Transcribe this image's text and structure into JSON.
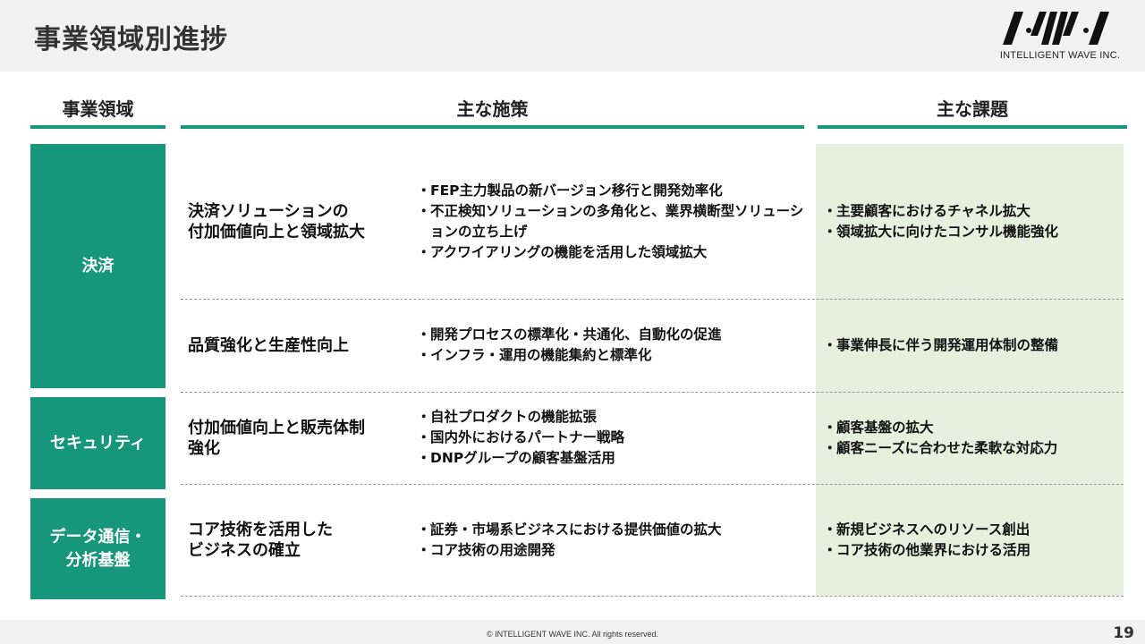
{
  "header": {
    "title": "事業領域別進捗",
    "logo_text": "INTELLIGENT WAVE INC."
  },
  "columns": {
    "domain": "事業領域",
    "measures": "主な施策",
    "issues": "主な課題"
  },
  "domains": [
    "決済",
    "セキュリティ",
    "データ通信・\n分析基盤"
  ],
  "rows": [
    {
      "category": "決済ソリューションの\n付加価値向上と領域拡大",
      "measures": [
        "FEP主力製品の新バージョン移行と開発効率化",
        "不正検知ソリューションの多角化と、業界横断型ソリューションの立ち上げ",
        "アクワイアリングの機能を活用した領域拡大"
      ],
      "issues": [
        "主要顧客におけるチャネル拡大",
        "領域拡大に向けたコンサル機能強化"
      ]
    },
    {
      "category": "品質強化と生産性向上",
      "measures": [
        "開発プロセスの標準化・共通化、自動化の促進",
        "インフラ・運用の機能集約と標準化"
      ],
      "issues": [
        "事業伸長に伴う開発運用体制の整備"
      ]
    },
    {
      "category": "付加価値向上と販売体制\n強化",
      "measures": [
        "自社プロダクトの機能拡張",
        "国内外におけるパートナー戦略",
        "DNPグループの顧客基盤活用"
      ],
      "issues": [
        "顧客基盤の拡大",
        "顧客ニーズに合わせた柔軟な対応力"
      ]
    },
    {
      "category": "コア技術を活用した\nビジネスの確立",
      "measures": [
        "証券・市場系ビジネスにおける提供価値の拡大",
        "コア技術の用途開発"
      ],
      "issues": [
        "新規ビジネスへのリソース創出",
        "コア技術の他業界における活用"
      ]
    }
  ],
  "bullet": "・",
  "footer": {
    "copyright": "© INTELLIGENT WAVE INC. All rights reserved.",
    "page_number": "19"
  },
  "colors": {
    "accent_green": "#16967a",
    "issue_background": "#e6f0dc",
    "header_background": "#f2f2f2"
  }
}
